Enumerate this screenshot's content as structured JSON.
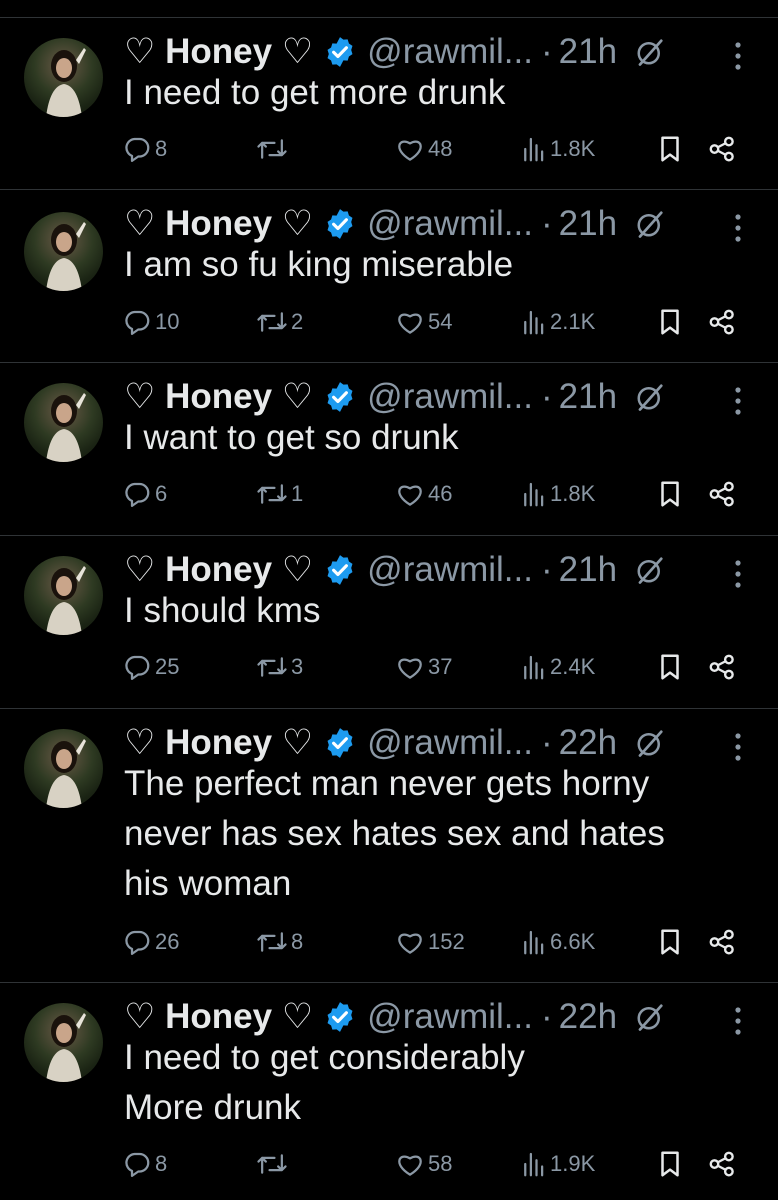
{
  "tweets": [
    {
      "name": "♡ Honey ♡",
      "handle": "@rawmil...",
      "dot": "·",
      "time": "21h",
      "text": "I need to get more drunk",
      "replies": "8",
      "retweets": "",
      "likes": "48",
      "views": "1.8K"
    },
    {
      "name": "♡ Honey ♡",
      "handle": "@rawmil...",
      "dot": "·",
      "time": "21h",
      "text": "I am so fu king miserable",
      "replies": "10",
      "retweets": "2",
      "likes": "54",
      "views": "2.1K"
    },
    {
      "name": "♡ Honey ♡",
      "handle": "@rawmil...",
      "dot": "·",
      "time": "21h",
      "text": "I want to get so drunk",
      "replies": "6",
      "retweets": "1",
      "likes": "46",
      "views": "1.8K"
    },
    {
      "name": "♡ Honey ♡",
      "handle": "@rawmil...",
      "dot": "·",
      "time": "21h",
      "text": "I should kms",
      "replies": "25",
      "retweets": "3",
      "likes": "37",
      "views": "2.4K"
    },
    {
      "name": "♡ Honey ♡",
      "handle": "@rawmil...",
      "dot": "·",
      "time": "22h",
      "text_lines": [
        "The perfect man never gets horny",
        "never has sex hates sex and hates",
        "his woman"
      ],
      "replies": "26",
      "retweets": "8",
      "likes": "152",
      "views": "6.6K"
    },
    {
      "name": "♡ Honey ♡",
      "handle": "@rawmil...",
      "dot": "·",
      "time": "22h",
      "text_lines": [
        "I need to get considerably",
        "More drunk"
      ],
      "replies": "8",
      "retweets": "",
      "likes": "58",
      "views": "1.9K"
    }
  ],
  "icons": {
    "verified": "verified-badge-icon",
    "grok": "grok-icon",
    "more": "more-options-icon",
    "reply": "reply-icon",
    "retweet": "retweet-icon",
    "like": "like-icon",
    "views": "views-icon",
    "bookmark": "bookmark-icon",
    "share": "share-icon"
  },
  "colors": {
    "background": "#000000",
    "text": "#e7e9ea",
    "secondary": "#8b98a5",
    "verified": "#1d9bf0",
    "divider": "#2f3336"
  }
}
